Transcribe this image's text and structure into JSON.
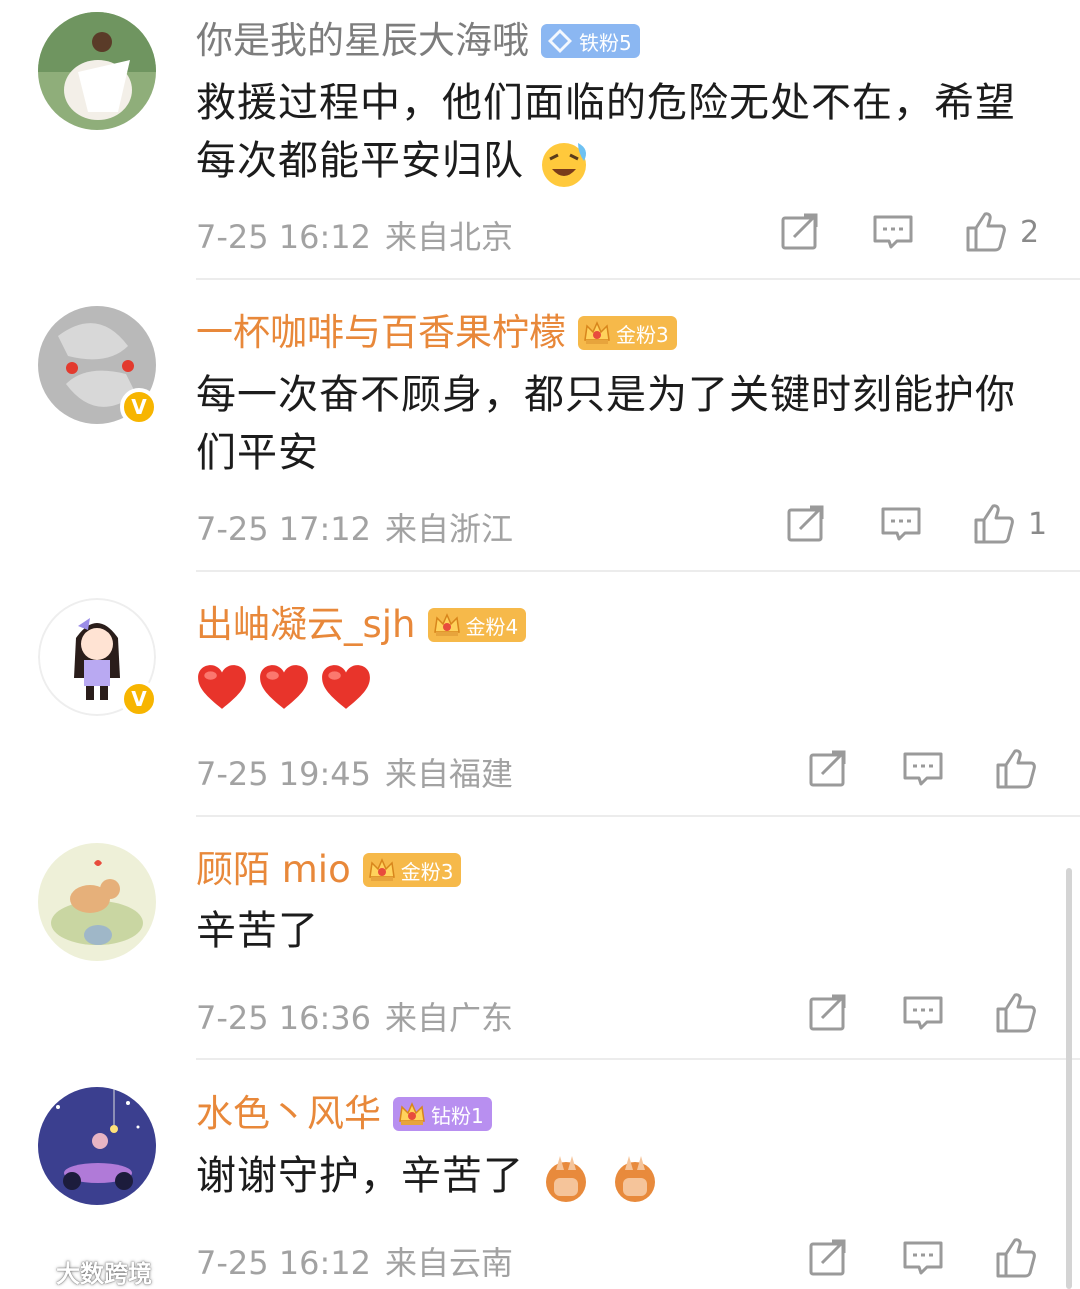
{
  "comments": [
    {
      "username": "你是我的星辰大海哦",
      "fan_badge": "铁粉5",
      "text": "救援过程中，他们面临的危险无处不在，希望每次都能平安归队",
      "date": "7-25 16:12",
      "location": "来自北京",
      "likes": "2",
      "emoji": "laughing-crying-emoji"
    },
    {
      "username": "一杯咖啡与百香果柠檬",
      "fan_badge": "金粉3",
      "text": "每一次奋不顾身，都只是为了关键时刻能护你们平安",
      "date": "7-25 17:12",
      "location": "来自浙江",
      "likes": "1",
      "verified": true
    },
    {
      "username": "出岫凝云_sjh",
      "fan_badge": "金粉4",
      "text": "",
      "emoji": "heart-emoji x3",
      "date": "7-25 19:45",
      "location": "来自福建",
      "likes": "",
      "verified": true
    },
    {
      "username": "顾陌 mio",
      "fan_badge": "金粉3",
      "text": "辛苦了",
      "date": "7-25 16:36",
      "location": "来自广东",
      "likes": ""
    },
    {
      "username": "水色丶风华",
      "fan_badge": "钻粉1",
      "text": "谢谢守护，辛苦了",
      "emoji": "clasped-hands-emoji x2",
      "date": "7-25 16:12",
      "location": "来自云南",
      "likes": ""
    }
  ],
  "watermark": "大数跨境",
  "icons": {
    "share": "share-icon",
    "reply": "comment-icon",
    "like": "thumbs-up-icon"
  },
  "colors": {
    "username_orange": "#e8883a",
    "username_gray": "#7d7d7d",
    "meta_gray": "#a2a2a2",
    "verified_yellow": "#f7b500"
  }
}
